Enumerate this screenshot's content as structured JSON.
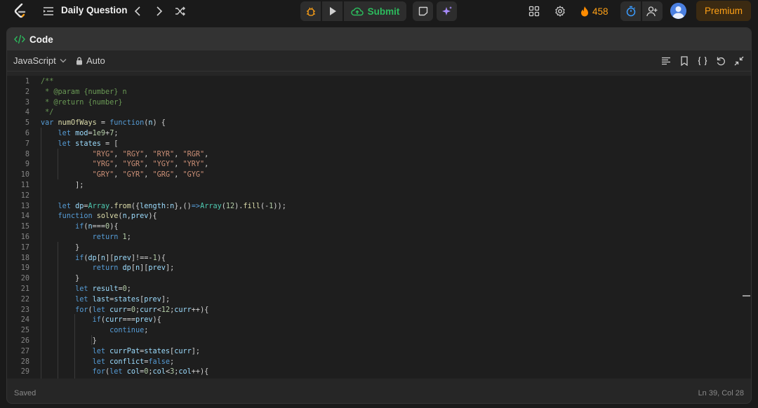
{
  "topbar": {
    "title": "Daily Question",
    "submit_label": "Submit",
    "streak_count": "458",
    "premium_label": "Premium"
  },
  "panel": {
    "title": "Code",
    "language": "JavaScript",
    "mode": "Auto"
  },
  "status": {
    "saved": "Saved",
    "cursor": "Ln 39, Col 28"
  },
  "editor": {
    "lines": [
      [
        [
          "/**",
          "c"
        ]
      ],
      [
        [
          " * @param {number} n",
          "c"
        ]
      ],
      [
        [
          " * @return {number}",
          "c"
        ]
      ],
      [
        [
          " */",
          "c"
        ]
      ],
      [
        [
          "var ",
          "k"
        ],
        [
          "numOfWays",
          "f"
        ],
        [
          " = ",
          "p"
        ],
        [
          "function",
          "k"
        ],
        [
          "(",
          "p"
        ],
        [
          "n",
          "v"
        ],
        [
          ") {",
          "p"
        ]
      ],
      [
        [
          "    ",
          "p"
        ],
        [
          "let ",
          "k"
        ],
        [
          "mod",
          "v"
        ],
        [
          "=",
          "p"
        ],
        [
          "1e9",
          "n"
        ],
        [
          "+",
          "p"
        ],
        [
          "7",
          "n"
        ],
        [
          ";",
          "p"
        ]
      ],
      [
        [
          "    ",
          "p"
        ],
        [
          "let ",
          "k"
        ],
        [
          "states",
          "v"
        ],
        [
          " = [",
          "p"
        ]
      ],
      [
        [
          "            ",
          "p"
        ],
        [
          "\"RYG\"",
          "s"
        ],
        [
          ", ",
          "p"
        ],
        [
          "\"RGY\"",
          "s"
        ],
        [
          ", ",
          "p"
        ],
        [
          "\"RYR\"",
          "s"
        ],
        [
          ", ",
          "p"
        ],
        [
          "\"RGR\"",
          "s"
        ],
        [
          ",",
          "p"
        ]
      ],
      [
        [
          "            ",
          "p"
        ],
        [
          "\"YRG\"",
          "s"
        ],
        [
          ", ",
          "p"
        ],
        [
          "\"YGR\"",
          "s"
        ],
        [
          ", ",
          "p"
        ],
        [
          "\"YGY\"",
          "s"
        ],
        [
          ", ",
          "p"
        ],
        [
          "\"YRY\"",
          "s"
        ],
        [
          ",",
          "p"
        ]
      ],
      [
        [
          "            ",
          "p"
        ],
        [
          "\"GRY\"",
          "s"
        ],
        [
          ", ",
          "p"
        ],
        [
          "\"GYR\"",
          "s"
        ],
        [
          ", ",
          "p"
        ],
        [
          "\"GRG\"",
          "s"
        ],
        [
          ", ",
          "p"
        ],
        [
          "\"GYG\"",
          "s"
        ]
      ],
      [
        [
          "        ];",
          "p"
        ]
      ],
      [
        [
          "",
          "p"
        ]
      ],
      [
        [
          "    ",
          "p"
        ],
        [
          "let ",
          "k"
        ],
        [
          "dp",
          "v"
        ],
        [
          "=",
          "p"
        ],
        [
          "Array",
          "t"
        ],
        [
          ".",
          "p"
        ],
        [
          "from",
          "f"
        ],
        [
          "({",
          "p"
        ],
        [
          "length",
          "v"
        ],
        [
          ":",
          "p"
        ],
        [
          "n",
          "v"
        ],
        [
          "},()",
          "p"
        ],
        [
          "=>",
          "k"
        ],
        [
          "Array",
          "t"
        ],
        [
          "(",
          "p"
        ],
        [
          "12",
          "n"
        ],
        [
          ").",
          "p"
        ],
        [
          "fill",
          "f"
        ],
        [
          "(-",
          "p"
        ],
        [
          "1",
          "n"
        ],
        [
          "));",
          "p"
        ]
      ],
      [
        [
          "    ",
          "p"
        ],
        [
          "function ",
          "k"
        ],
        [
          "solve",
          "f"
        ],
        [
          "(",
          "p"
        ],
        [
          "n",
          "v"
        ],
        [
          ",",
          "p"
        ],
        [
          "prev",
          "v"
        ],
        [
          "){",
          "p"
        ]
      ],
      [
        [
          "        ",
          "p"
        ],
        [
          "if",
          "k"
        ],
        [
          "(",
          "p"
        ],
        [
          "n",
          "v"
        ],
        [
          "===",
          "p"
        ],
        [
          "0",
          "n"
        ],
        [
          "){",
          "p"
        ]
      ],
      [
        [
          "            ",
          "p"
        ],
        [
          "return ",
          "k"
        ],
        [
          "1",
          "n"
        ],
        [
          ";",
          "p"
        ]
      ],
      [
        [
          "        }",
          "p"
        ]
      ],
      [
        [
          "        ",
          "p"
        ],
        [
          "if",
          "k"
        ],
        [
          "(",
          "p"
        ],
        [
          "dp",
          "v"
        ],
        [
          "[",
          "p"
        ],
        [
          "n",
          "v"
        ],
        [
          "][",
          "p"
        ],
        [
          "prev",
          "v"
        ],
        [
          "]!==-",
          "p"
        ],
        [
          "1",
          "n"
        ],
        [
          "){",
          "p"
        ]
      ],
      [
        [
          "            ",
          "p"
        ],
        [
          "return ",
          "k"
        ],
        [
          "dp",
          "v"
        ],
        [
          "[",
          "p"
        ],
        [
          "n",
          "v"
        ],
        [
          "][",
          "p"
        ],
        [
          "prev",
          "v"
        ],
        [
          "];",
          "p"
        ]
      ],
      [
        [
          "        }",
          "p"
        ]
      ],
      [
        [
          "        ",
          "p"
        ],
        [
          "let ",
          "k"
        ],
        [
          "result",
          "v"
        ],
        [
          "=",
          "p"
        ],
        [
          "0",
          "n"
        ],
        [
          ";",
          "p"
        ]
      ],
      [
        [
          "        ",
          "p"
        ],
        [
          "let ",
          "k"
        ],
        [
          "last",
          "v"
        ],
        [
          "=",
          "p"
        ],
        [
          "states",
          "v"
        ],
        [
          "[",
          "p"
        ],
        [
          "prev",
          "v"
        ],
        [
          "];",
          "p"
        ]
      ],
      [
        [
          "        ",
          "p"
        ],
        [
          "for",
          "k"
        ],
        [
          "(",
          "p"
        ],
        [
          "let ",
          "k"
        ],
        [
          "curr",
          "v"
        ],
        [
          "=",
          "p"
        ],
        [
          "0",
          "n"
        ],
        [
          ";",
          "p"
        ],
        [
          "curr",
          "v"
        ],
        [
          "<",
          "p"
        ],
        [
          "12",
          "n"
        ],
        [
          ";",
          "p"
        ],
        [
          "curr",
          "v"
        ],
        [
          "++){",
          "p"
        ]
      ],
      [
        [
          "            ",
          "p"
        ],
        [
          "if",
          "k"
        ],
        [
          "(",
          "p"
        ],
        [
          "curr",
          "v"
        ],
        [
          "===",
          "p"
        ],
        [
          "prev",
          "v"
        ],
        [
          "){",
          "p"
        ]
      ],
      [
        [
          "                ",
          "p"
        ],
        [
          "continue",
          "k"
        ],
        [
          ";",
          "p"
        ]
      ],
      [
        [
          "            }",
          "p"
        ]
      ],
      [
        [
          "            ",
          "p"
        ],
        [
          "let ",
          "k"
        ],
        [
          "currPat",
          "v"
        ],
        [
          "=",
          "p"
        ],
        [
          "states",
          "v"
        ],
        [
          "[",
          "p"
        ],
        [
          "curr",
          "v"
        ],
        [
          "];",
          "p"
        ]
      ],
      [
        [
          "            ",
          "p"
        ],
        [
          "let ",
          "k"
        ],
        [
          "conflict",
          "v"
        ],
        [
          "=",
          "p"
        ],
        [
          "false",
          "k"
        ],
        [
          ";",
          "p"
        ]
      ],
      [
        [
          "            ",
          "p"
        ],
        [
          "for",
          "k"
        ],
        [
          "(",
          "p"
        ],
        [
          "let ",
          "k"
        ],
        [
          "col",
          "v"
        ],
        [
          "=",
          "p"
        ],
        [
          "0",
          "n"
        ],
        [
          ";",
          "p"
        ],
        [
          "col",
          "v"
        ],
        [
          "<",
          "p"
        ],
        [
          "3",
          "n"
        ],
        [
          ";",
          "p"
        ],
        [
          "col",
          "v"
        ],
        [
          "++){",
          "p"
        ]
      ]
    ]
  }
}
